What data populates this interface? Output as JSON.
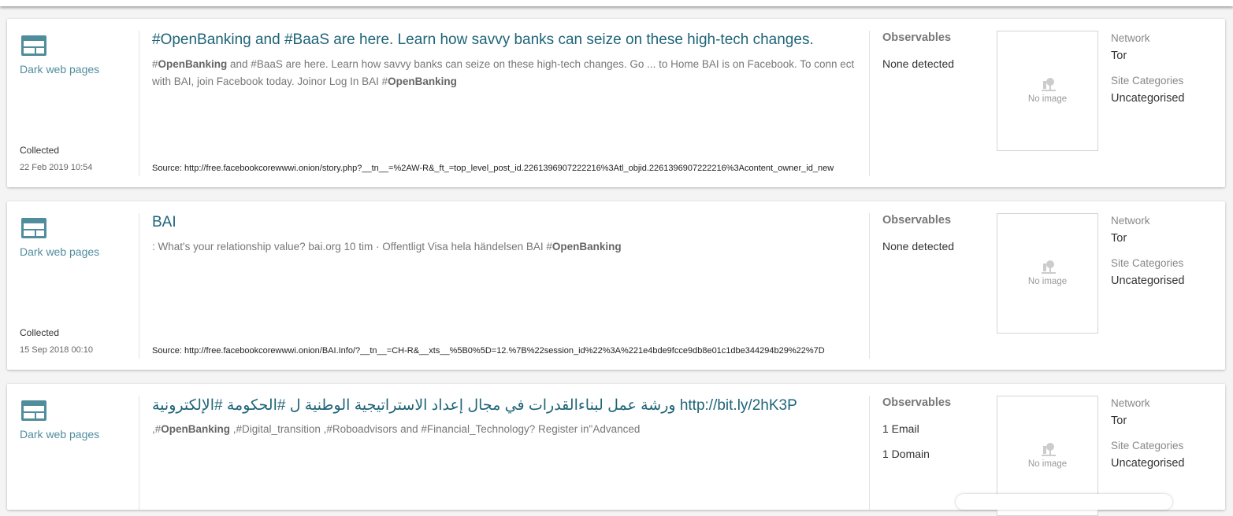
{
  "results": [
    {
      "type_label": "Dark web pages",
      "collected_label": "Collected",
      "collected_date": "22 Feb 2019 10:54",
      "title": "#OpenBanking and #BaaS are here. Learn how savvy banks can seize on these high-tech changes.",
      "snippet": {
        "p1": "#",
        "b1": "OpenBanking",
        "p2": " and #BaaS are here. Learn how savvy banks can seize on these high-tech changes. Go ... to Home BAI is on Facebook. To conn ect with BAI, join Facebook today. Joinor Log In BAI #",
        "b2": "OpenBanking",
        "p3": ""
      },
      "source": "Source: http://free.facebookcorewwwi.onion/story.php?__tn__=%2AW-R&_ft_=top_level_post_id.2261396907222216%3Atl_objid.2261396907222216%3Acontent_owner_id_new",
      "observables_heading": "Observables",
      "observables": [
        "None detected"
      ],
      "no_image_text": "No image",
      "network_label": "Network",
      "network_value": "Tor",
      "site_categories_label": "Site Categories",
      "site_categories_value": "Uncategorised"
    },
    {
      "type_label": "Dark web pages",
      "collected_label": "Collected",
      "collected_date": "15 Sep 2018 00:10",
      "title": "BAI",
      "snippet": {
        "p1": ": What's your relationship value? bai.org 10 tim · Offentligt Visa hela händelsen BAI #",
        "b1": "OpenBanking",
        "p2": "",
        "b2": "",
        "p3": ""
      },
      "source": "Source: http://free.facebookcorewwwi.onion/BAI.Info/?__tn__=CH-R&__xts__%5B0%5D=12.%7B%22session_id%22%3A%221e4bde9fcce9db8e01c1dbe344294b29%22%7D",
      "observables_heading": "Observables",
      "observables": [
        "None detected"
      ],
      "no_image_text": "No image",
      "network_label": "Network",
      "network_value": "Tor",
      "site_categories_label": "Site Categories",
      "site_categories_value": "Uncategorised"
    },
    {
      "type_label": "Dark web pages",
      "collected_label": "",
      "collected_date": "",
      "title": "ورشة عمل لبناءالقدرات في مجال إعداد الاستراتيجية الوطنية ل #الحكومة #الإلكترونية http://bit.ly/2hK3P",
      "snippet": {
        "p1": ",#",
        "b1": "OpenBanking",
        "p2": " ,#Digital_transition ,#Roboadvisors and #Financial_Technology? Register in\"Advanced",
        "b2": "",
        "p3": ""
      },
      "source": "",
      "observables_heading": "Observables",
      "observables": [
        "1 Email",
        "1 Domain"
      ],
      "no_image_text": "No image",
      "network_label": "Network",
      "network_value": "Tor",
      "site_categories_label": "Site Categories",
      "site_categories_value": "Uncategorised"
    }
  ],
  "colors": {
    "type_icon": "#4f8d9d",
    "title": "#1e6478",
    "background": "#f4f4f4"
  },
  "icons": {
    "type_icon": "browser-window-icon",
    "thumb_icon": "no-image-icon"
  }
}
